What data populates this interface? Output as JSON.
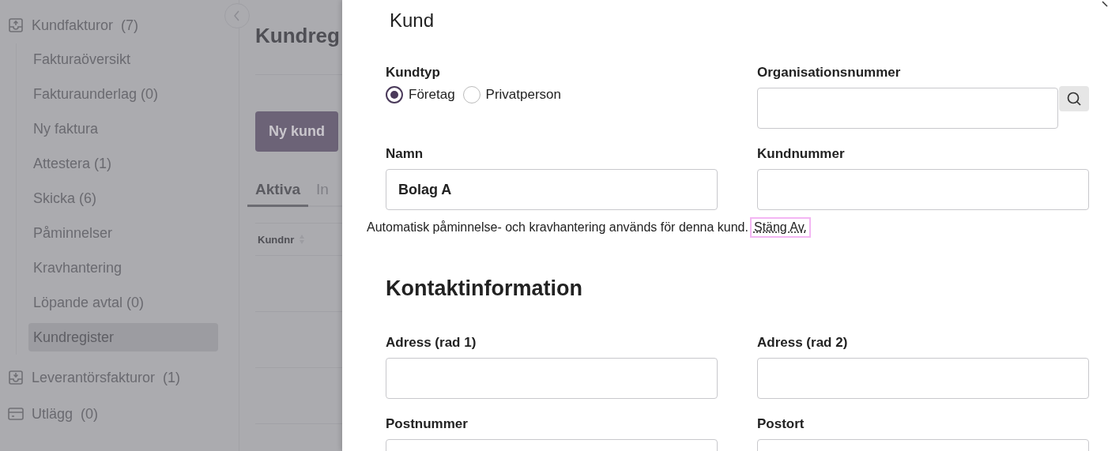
{
  "sidebar": {
    "groups": [
      {
        "label": "Kundfakturor",
        "count": "(7)",
        "children": [
          {
            "label": "Fakturaöversikt",
            "selected": false
          },
          {
            "label": "Fakturaunderlag (0)",
            "selected": false
          },
          {
            "label": "Ny faktura",
            "selected": false
          },
          {
            "label": "Attestera (1)",
            "selected": false
          },
          {
            "label": "Skicka (6)",
            "selected": false
          },
          {
            "label": "Påminnelser",
            "selected": false
          },
          {
            "label": "Kravhantering",
            "selected": false
          },
          {
            "label": "Löpande avtal (0)",
            "selected": false
          },
          {
            "label": "Kundregister",
            "selected": true
          }
        ]
      },
      {
        "label": "Leverantörsfakturor",
        "count": "(1)"
      },
      {
        "label": "Utlägg",
        "count": "(0)"
      }
    ]
  },
  "main": {
    "title": "Kundreg",
    "new_button": "Ny kund",
    "tabs": [
      {
        "label": "Aktiva",
        "selected": true
      },
      {
        "label": "In",
        "selected": false
      }
    ],
    "table": {
      "columns": [
        "Kundnr"
      ]
    }
  },
  "panel": {
    "title": "Kund",
    "fields": [
      {
        "kind": "radio",
        "label": "Kundtyp",
        "options": [
          {
            "label": "Företag",
            "selected": true
          },
          {
            "label": "Privatperson",
            "selected": false
          }
        ]
      },
      {
        "kind": "search",
        "label": "Organisationsnummer"
      },
      {
        "kind": "text",
        "label": "Namn",
        "value": "Bolag A"
      },
      {
        "kind": "text",
        "label": "Kundnummer"
      }
    ],
    "notice": {
      "text": "Automatisk påminnelse- och kravhantering används för denna kund.",
      "link": "Stäng Av.",
      "focused": true
    },
    "section": "Kontaktinformation",
    "contact_fields": [
      {
        "kind": "text",
        "label": "Adress (rad 1)"
      },
      {
        "kind": "text",
        "label": "Adress (rad 2)"
      },
      {
        "kind": "text",
        "label": "Postnummer"
      },
      {
        "kind": "text",
        "label": "Postort"
      }
    ]
  }
}
